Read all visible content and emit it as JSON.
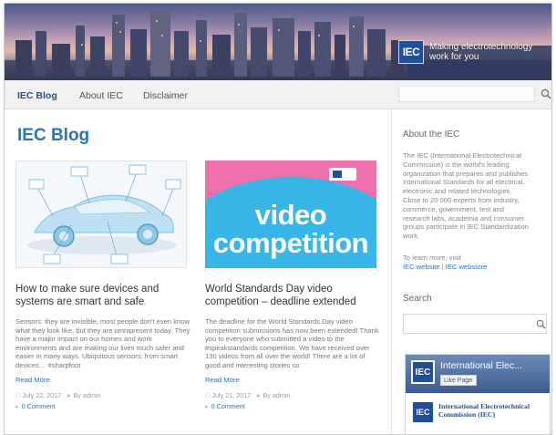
{
  "header": {
    "logo_text": "IEC",
    "tagline": "Making electrotechnology work for you"
  },
  "nav": {
    "items": [
      {
        "label": "IEC Blog"
      },
      {
        "label": "About IEC"
      },
      {
        "label": "Disclaimer"
      }
    ],
    "search_placeholder": ""
  },
  "main": {
    "title": "IEC Blog",
    "posts": [
      {
        "title": "How to make sure devices and systems are smart and safe",
        "excerpt": "Sensors: they are invisible, most people don't even know what they look like, but they are omnipresent today. They have a major impact on our homes and work environments and are making our lives much safer and easier in many ways. Ubiquitous sensors: from smart devices… #sharpfoot",
        "more": "Read More",
        "date": "July 22, 2017",
        "author": "By admin",
        "comments": "0 Comment"
      },
      {
        "title": "World Standards Day video competition – deadline extended",
        "image_line1": "video",
        "image_line2": "competition",
        "excerpt": "The deadline for the World Standards Day video competition submissions has now been extended! Thank you to everyone who submitted a video to the #speakstandards competition. We have received over 130 videos from all over the world! There are a lot of good and interesting stories so",
        "more": "Read More",
        "date": "July 21, 2017",
        "author": "By admin",
        "comments": "0 Comment"
      }
    ]
  },
  "sidebar": {
    "about_heading": "About the IEC",
    "about_text": "The IEC (International Electrotechnical Commission) is the world's leading organization that prepares and publishes International Standards for all electrical, electronic and related technologies. Close to 20 000 experts from industry, commerce, government, test and research labs, academia and consumer groups participate in IEC Standardization work.",
    "learn_prefix": "To learn more, visit",
    "learn_link1": "IEC website",
    "learn_sep": " | ",
    "learn_link2": "IEC webstore",
    "search_heading": "Search",
    "search_placeholder": "",
    "facebook": {
      "page_name": "International Elec...",
      "like_label": "Like Page",
      "logo": "IEC",
      "post_author": "International Electrotechnical Commission (IEC)"
    }
  },
  "colors": {
    "accent": "#2b74b8",
    "iec_blue": "#1f4e9a",
    "video_pink": "#ee71ae",
    "video_blue": "#39b6e8"
  }
}
